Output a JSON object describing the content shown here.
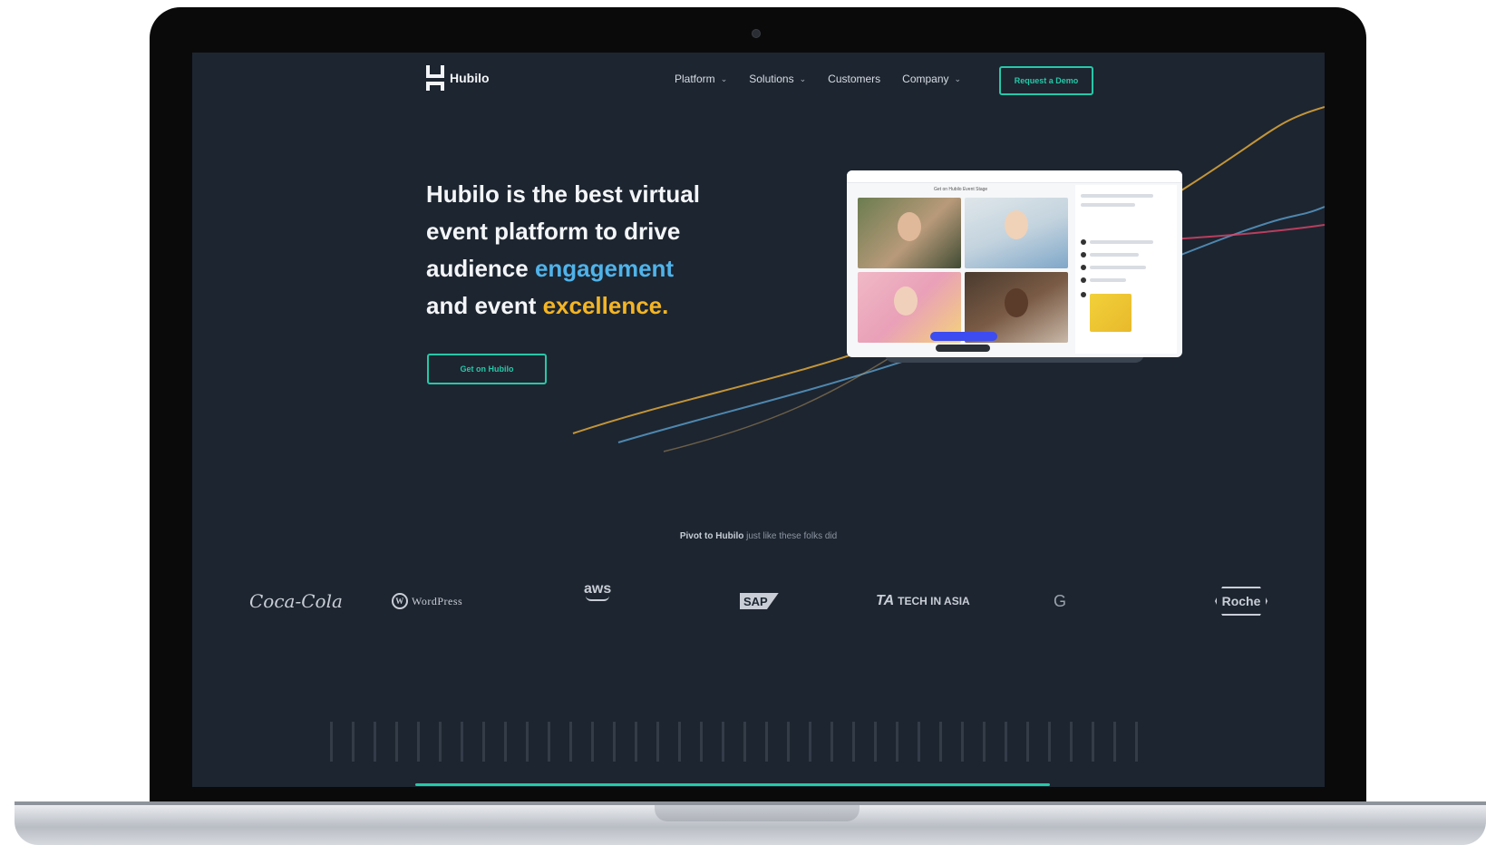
{
  "nav": {
    "brand": "Hubilo",
    "menu": [
      {
        "label": "Platform",
        "has_dropdown": true
      },
      {
        "label": "Solutions",
        "has_dropdown": true
      },
      {
        "label": "Customers",
        "has_dropdown": false
      },
      {
        "label": "Company",
        "has_dropdown": true
      }
    ],
    "cta_label": "Request a Demo"
  },
  "hero": {
    "line1": "Hubilo is the best virtual",
    "line2": "event platform to drive",
    "line3_prefix": "audience ",
    "line3_highlight": "engagement",
    "line4_prefix": "and event ",
    "line4_highlight": "excellence.",
    "cta_label": "Get on Hubilo"
  },
  "mockup": {
    "window_title": "Get on Hubilo Event Stage"
  },
  "social_proof": {
    "lead_bold": "Pivot to Hubilo",
    "lead_rest": " just like these folks did",
    "logos": [
      "Coca-Cola",
      "WordPress",
      "aws",
      "SAP",
      "TECH IN ASIA",
      "G",
      "Roche"
    ]
  },
  "colors": {
    "background": "#1d2530",
    "accent_teal": "#27c8a8",
    "highlight_blue": "#4fb3ea",
    "highlight_yellow": "#f4b524"
  },
  "icons": {
    "chevron": "chevron-down-icon",
    "wordpress": "wordpress-logo-icon"
  }
}
